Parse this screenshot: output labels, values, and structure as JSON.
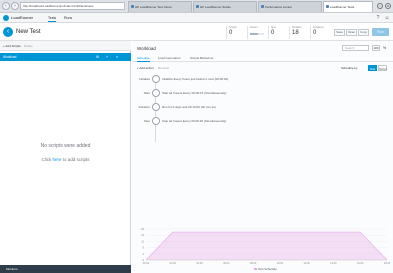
{
  "browser": {
    "address": "http://localhost/LoadRunner/pc/index.html#/tests/new",
    "tabs": [
      {
        "label": "HP LoadRunner Test Cloud"
      },
      {
        "label": "HP LoadRunner Studio"
      },
      {
        "label": "Performance Center"
      },
      {
        "label": "LoadRunner Tests"
      }
    ]
  },
  "app": {
    "brand": "LoadRunner",
    "nav": [
      {
        "label": "Tests"
      },
      {
        "label": "Runs"
      }
    ]
  },
  "test": {
    "back_symbol": "‹",
    "title": "New Test",
    "stats": [
      {
        "label": "Scripts",
        "value": "0"
      },
      {
        "label": "Vusers",
        "value": "0"
      },
      {
        "label": "SLA",
        "value": "0"
      },
      {
        "label": "Duration",
        "value": "18"
      },
      {
        "label": "Locations",
        "value": "0"
      }
    ],
    "controls": [
      "Save",
      "Open",
      "Copy"
    ],
    "run_label": "Run"
  },
  "scripts_panel": {
    "add_label": "+ Add Scripts",
    "delete_label": "Delete",
    "group_label": "Workload",
    "empty_message": "No scripts were added",
    "add_hint_prefix": "Click ",
    "add_hint_link": "here",
    "add_hint_suffix": " to add scripts",
    "footer_label": "Monitors"
  },
  "workload": {
    "title": "Workload",
    "search_placeholder": "Search",
    "percent_box": "100",
    "percent_label": "%",
    "tabs": [
      {
        "label": "Schedule"
      },
      {
        "label": "Load Generators"
      },
      {
        "label": "Scripts Behaviour"
      }
    ],
    "add_action": "+ Add action",
    "remove_action": "Remove",
    "mode_label": "Schedule by",
    "mode_options": [
      "Test",
      "Script"
    ],
    "steps": [
      {
        "label": "Initialize",
        "text": "Initialize  Every Vuser just before it runs (00:00:00)"
      },
      {
        "label": "Start",
        "text": "Start all Vusers  Every 00:00:15 (Simultaneously)"
      },
      {
        "label": "Duration",
        "text": "Run for 0 days and 00:10:00 (hh:mm:ss)"
      },
      {
        "label": "Stop",
        "text": "Stop all Vusers  Every 00:00:15 (Simultaneously)"
      }
    ]
  },
  "chart_data": {
    "type": "area",
    "title": "",
    "xlabel": "",
    "ylabel": "",
    "x": [
      "00:00",
      "02:00",
      "04:00",
      "06:00",
      "08:00",
      "10:00",
      "12:00",
      "14:00",
      "16:00",
      "18:00"
    ],
    "series": [
      {
        "name": "Test Schedule",
        "color": "#e6a6e6",
        "values": [
          0,
          18,
          18,
          18,
          18,
          18,
          18,
          18,
          18,
          0
        ]
      }
    ],
    "ylim": [
      0,
      20
    ],
    "grid": true,
    "legend": "bottom"
  }
}
